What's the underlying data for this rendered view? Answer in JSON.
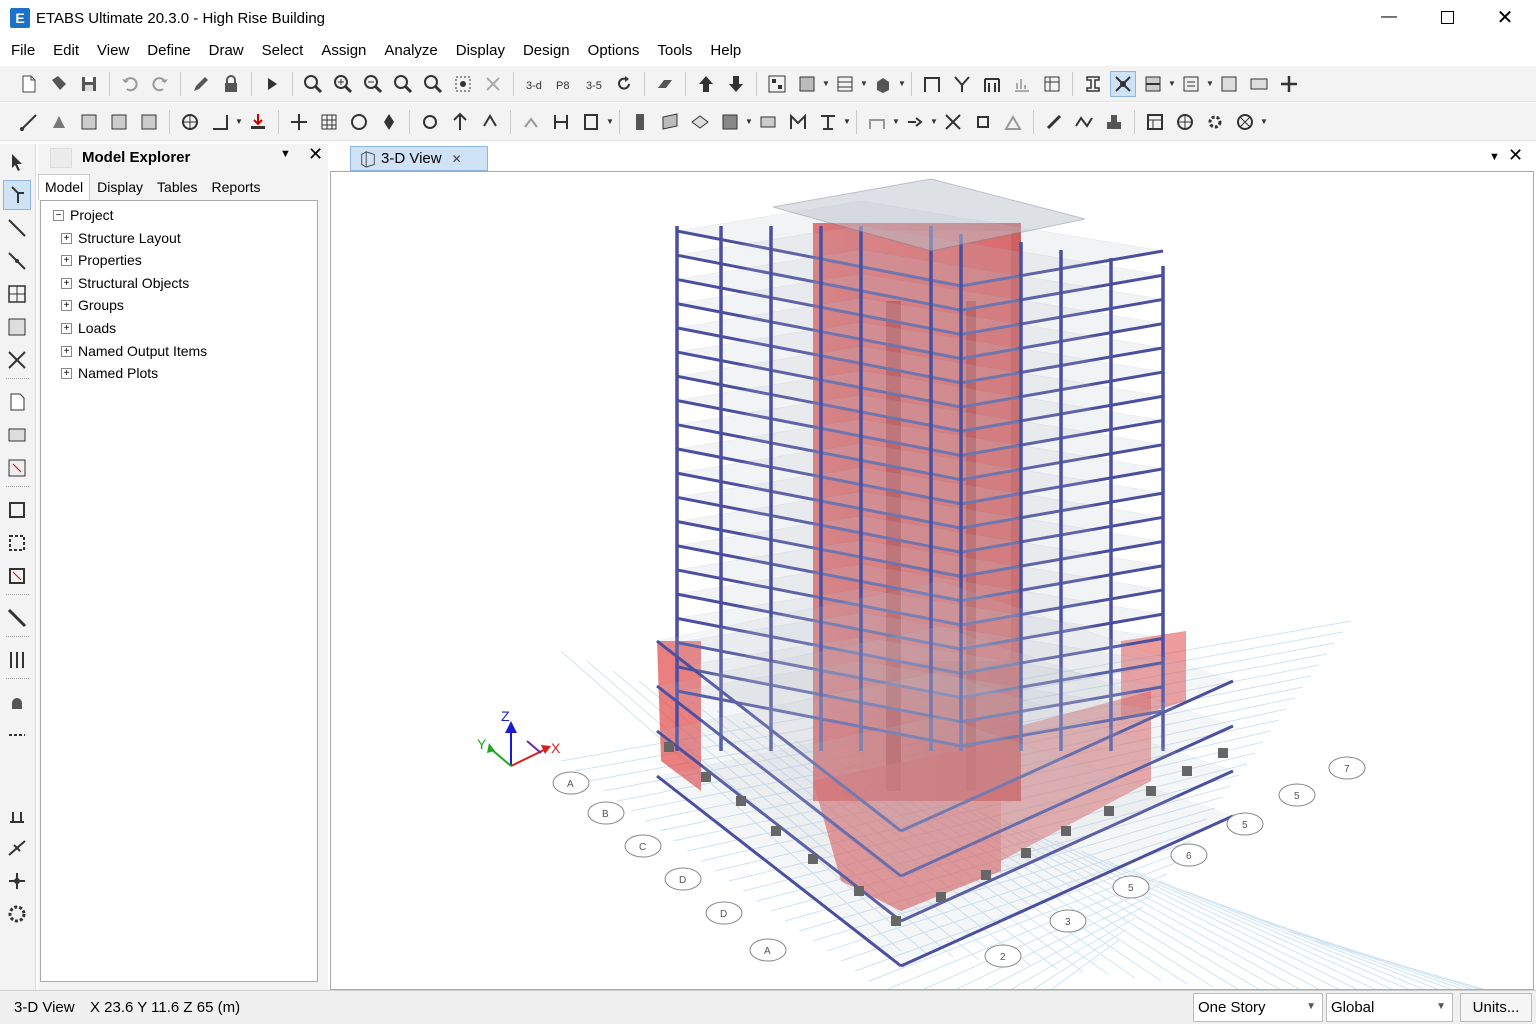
{
  "window": {
    "title": "ETABS Ultimate 20.3.0 - High Rise Building",
    "app_icon_letter": "E"
  },
  "menu": [
    "File",
    "Edit",
    "View",
    "Define",
    "Draw",
    "Select",
    "Assign",
    "Analyze",
    "Display",
    "Design",
    "Options",
    "Tools",
    "Help"
  ],
  "explorer": {
    "title": "Model Explorer",
    "tabs": [
      "Model",
      "Display",
      "Tables",
      "Reports"
    ],
    "active_tab": "Model",
    "tree": {
      "root": "Project",
      "children": [
        "Structure Layout",
        "Properties",
        "Structural Objects",
        "Groups",
        "Loads",
        "Named Output Items",
        "Named Plots"
      ]
    }
  },
  "view": {
    "tab_label": "3-D View",
    "axes": {
      "z": "Z",
      "y": "Y",
      "x": "X"
    },
    "grid_bubbles": {
      "letters": [
        "A",
        "B",
        "C",
        "D",
        "D",
        "A"
      ],
      "numbers": [
        "2",
        "3",
        "5",
        "6",
        "5",
        "5",
        "7"
      ]
    }
  },
  "status": {
    "view_name": "3-D View",
    "coords": "X 23.6  Y 11.6  Z 65 (m)",
    "story_select": "One Story",
    "coord_select": "Global",
    "units_button": "Units..."
  },
  "colors": {
    "frame": "#4b4fa0",
    "core": "#e43a3a",
    "slab": "#bcc3cc",
    "grid": "#cfe4f4",
    "accent": "#1a73c8"
  }
}
